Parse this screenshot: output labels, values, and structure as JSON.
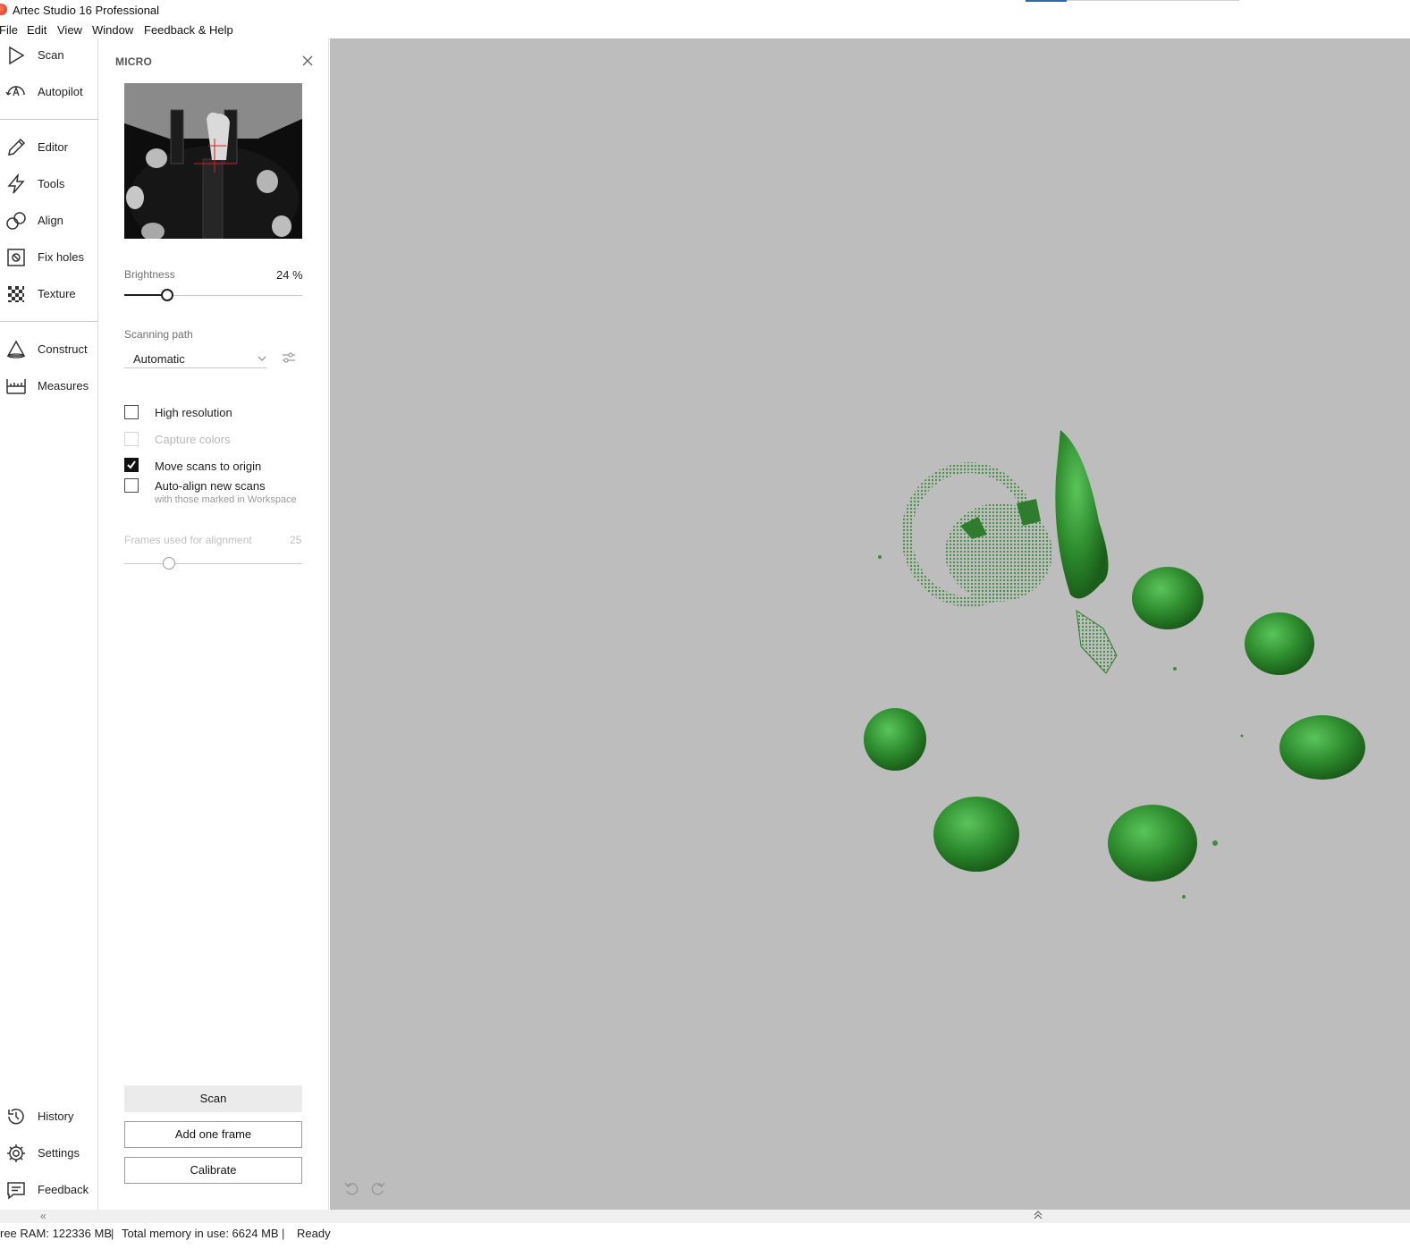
{
  "window": {
    "title": "Artec Studio 16 Professional"
  },
  "menu": [
    "File",
    "Edit",
    "View",
    "Window",
    "Feedback & Help"
  ],
  "nav": {
    "top": [
      {
        "label": "Scan",
        "icon": "play-icon"
      },
      {
        "label": "Autopilot",
        "icon": "autopilot-icon"
      }
    ],
    "middle": [
      {
        "label": "Editor",
        "icon": "pencil-icon"
      },
      {
        "label": "Tools",
        "icon": "lightning-icon"
      },
      {
        "label": "Align",
        "icon": "align-icon"
      },
      {
        "label": "Fix holes",
        "icon": "fix-holes-icon"
      },
      {
        "label": "Texture",
        "icon": "checkerboard-icon"
      }
    ],
    "lower": [
      {
        "label": "Construct",
        "icon": "cone-icon"
      },
      {
        "label": "Measures",
        "icon": "ruler-icon"
      }
    ],
    "bottom": [
      {
        "label": "History",
        "icon": "history-icon"
      },
      {
        "label": "Settings",
        "icon": "gear-icon"
      },
      {
        "label": "Feedback",
        "icon": "comment-icon"
      }
    ]
  },
  "panel": {
    "title": "MICRO",
    "brightness": {
      "label": "Brightness",
      "value_text": "24 %",
      "value": 0.24
    },
    "scanning_path": {
      "label": "Scanning path",
      "value": "Automatic"
    },
    "options": {
      "high_resolution": {
        "label": "High resolution",
        "checked": false
      },
      "capture_colors": {
        "label": "Capture colors",
        "checked": false,
        "disabled": true
      },
      "move_to_origin": {
        "label": "Move scans to origin",
        "checked": true
      },
      "auto_align": {
        "label": "Auto-align new scans",
        "sublabel": "with those marked in Workspace",
        "checked": false
      }
    },
    "frames": {
      "label": "Frames used for alignment",
      "value": "25",
      "level": 0.25
    },
    "buttons": {
      "scan": "Scan",
      "add_frame": "Add one frame",
      "calibrate": "Calibrate"
    }
  },
  "colors": {
    "model_green": "#3a9a3a",
    "viewport_bg": "#bdbdbd",
    "accent": "#2b6cb0"
  },
  "status": {
    "free_ram": "ree RAM: 122336 MB",
    "total_memory": "Total memory in use: 6624 MB",
    "state": "Ready"
  }
}
